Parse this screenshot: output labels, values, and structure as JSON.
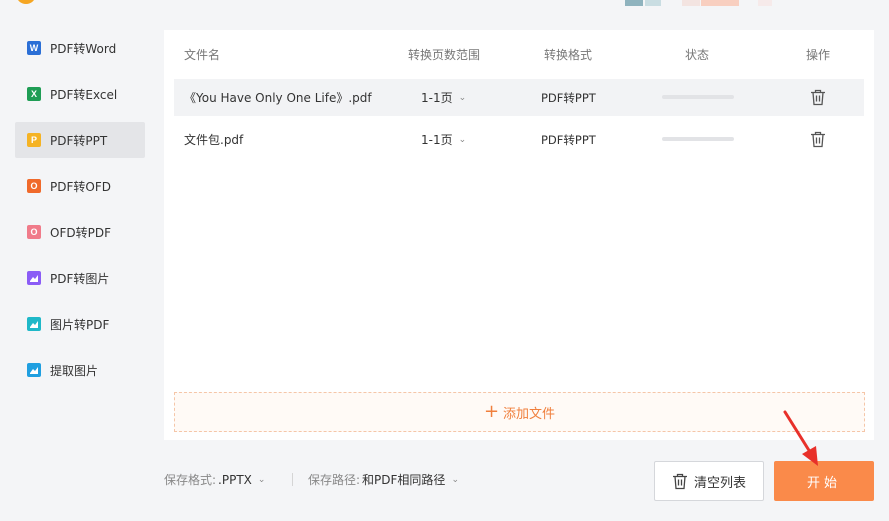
{
  "sidebar": {
    "items": [
      {
        "label": "PDF转Word",
        "icon": "word-icon",
        "glyph": "W",
        "color": "#2b6fd6",
        "active": false
      },
      {
        "label": "PDF转Excel",
        "icon": "excel-icon",
        "glyph": "X",
        "color": "#1f9d55",
        "active": false
      },
      {
        "label": "PDF转PPT",
        "icon": "ppt-icon",
        "glyph": "P",
        "color": "#f5b324",
        "active": true
      },
      {
        "label": "PDF转OFD",
        "icon": "ofd-icon",
        "glyph": "O",
        "color": "#f06a2b",
        "active": false
      },
      {
        "label": "OFD转PDF",
        "icon": "ofd-pdf-icon",
        "glyph": "O",
        "color": "#f07b8a",
        "active": false
      },
      {
        "label": "PDF转图片",
        "icon": "pdf-image-icon",
        "glyph": "",
        "color": "#8b5cf6",
        "active": false
      },
      {
        "label": "图片转PDF",
        "icon": "image-pdf-icon",
        "glyph": "",
        "color": "#1fb8c8",
        "active": false
      },
      {
        "label": "提取图片",
        "icon": "extract-image-icon",
        "glyph": "",
        "color": "#1f9fe0",
        "active": false
      }
    ]
  },
  "table": {
    "headers": {
      "name": "文件名",
      "range": "转换页数范围",
      "format": "转换格式",
      "status": "状态",
      "op": "操作"
    },
    "rows": [
      {
        "name": "《You Have Only One Life》.pdf",
        "range": "1-1页",
        "format": "PDF转PPT",
        "progress": 0
      },
      {
        "name": "文件包.pdf",
        "range": "1-1页",
        "format": "PDF转PPT",
        "progress": 0
      }
    ]
  },
  "add_file": {
    "label": "添加文件"
  },
  "footer": {
    "save_format_label": "保存格式:",
    "save_format_value": ".PPTX",
    "save_path_label": "保存路径:",
    "save_path_value": "和PDF相同路径",
    "clear_label": "清空列表",
    "start_label": "开始"
  },
  "colors": {
    "accent": "#fa8a4a",
    "arrow": "#e8302a"
  }
}
